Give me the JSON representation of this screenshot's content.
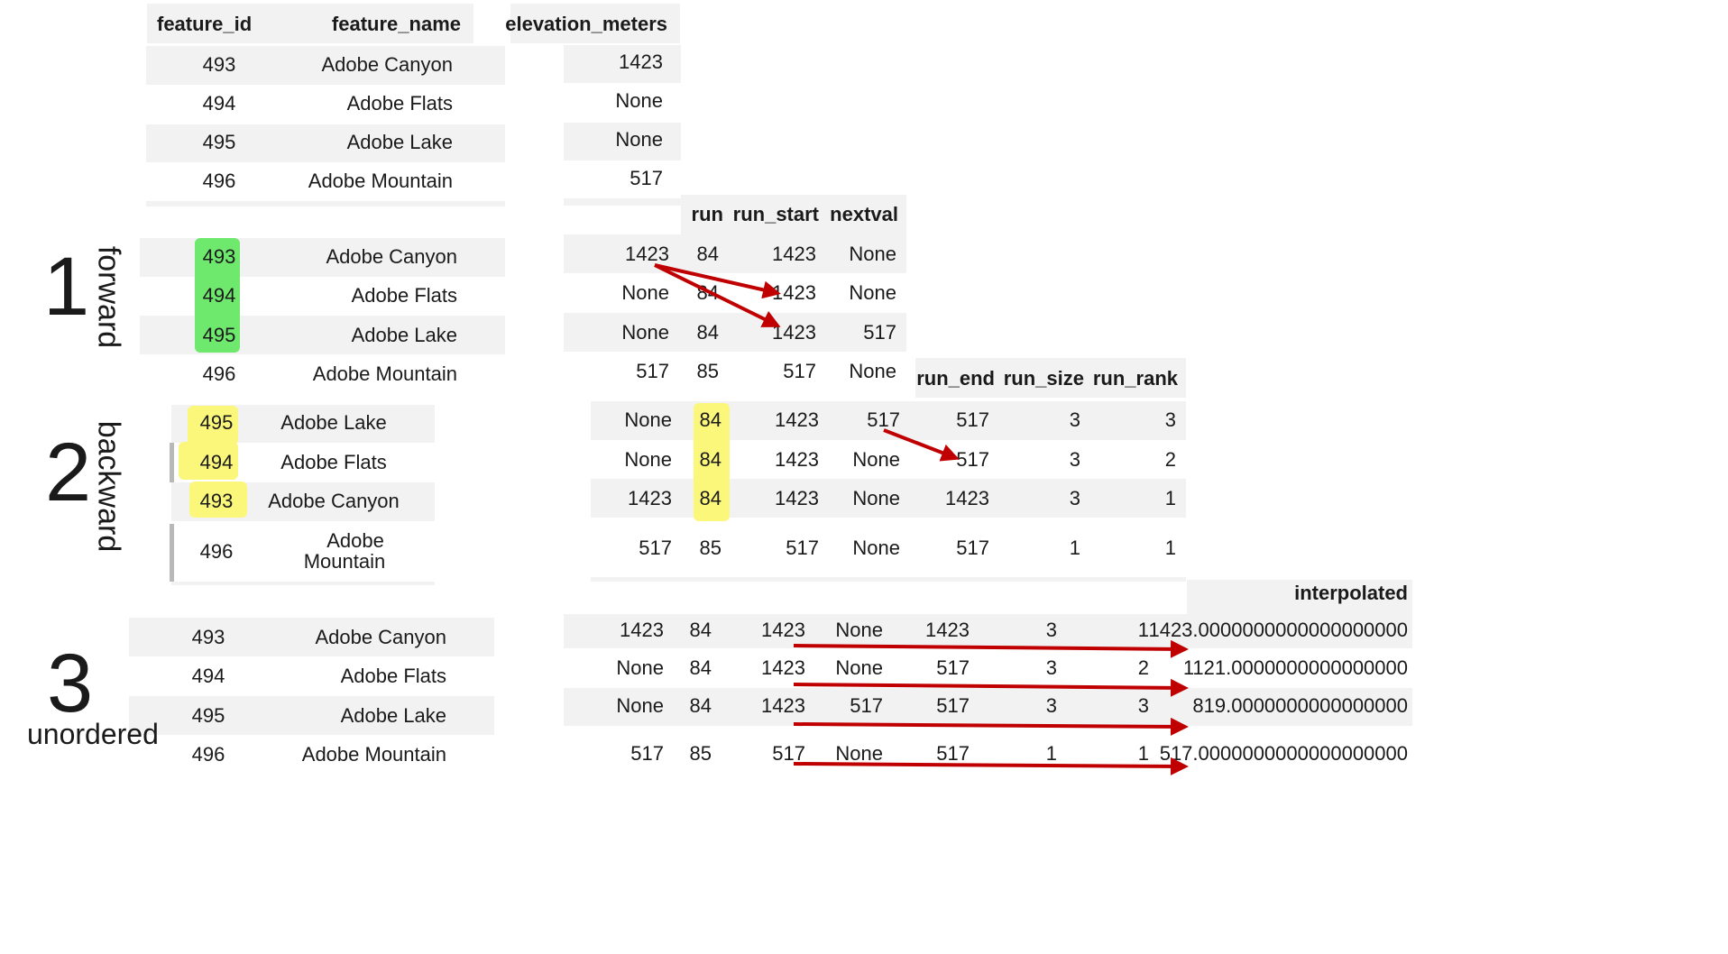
{
  "colors": {
    "row_band": "#f2f2f2",
    "green_highlight": "#6ee96e",
    "yellow_highlight": "#fbf77a",
    "arrow": "#c00000"
  },
  "section_labels": {
    "s1_number": "1",
    "s1_word": "forward",
    "s2_number": "2",
    "s2_word": "backward",
    "s3_number": "3",
    "s3_word": "unordered"
  },
  "headers": {
    "feature_id": "feature_id",
    "feature_name": "feature_name",
    "elevation_meters": "elevation_meters",
    "run": "run",
    "run_start": "run_start",
    "nextval": "nextval",
    "run_end": "run_end",
    "run_size": "run_size",
    "run_rank": "run_rank",
    "interpolated": "interpolated"
  },
  "table0": [
    {
      "id": "493",
      "name": "Adobe Canyon",
      "elev": "1423"
    },
    {
      "id": "494",
      "name": "Adobe Flats",
      "elev": "None"
    },
    {
      "id": "495",
      "name": "Adobe Lake",
      "elev": "None"
    },
    {
      "id": "496",
      "name": "Adobe Mountain",
      "elev": "517"
    }
  ],
  "forward": [
    {
      "id": "493",
      "name": "Adobe Canyon",
      "elev": "1423",
      "run": "84",
      "run_start": "1423",
      "nextval": "None"
    },
    {
      "id": "494",
      "name": "Adobe Flats",
      "elev": "None",
      "run": "84",
      "run_start": "1423",
      "nextval": "None"
    },
    {
      "id": "495",
      "name": "Adobe Lake",
      "elev": "None",
      "run": "84",
      "run_start": "1423",
      "nextval": "517"
    },
    {
      "id": "496",
      "name": "Adobe Mountain",
      "elev": "517",
      "run": "85",
      "run_start": "517",
      "nextval": "None"
    }
  ],
  "backward": [
    {
      "id": "495",
      "name": "Adobe Lake",
      "elev": "None",
      "run": "84",
      "run_start": "1423",
      "nextval": "517",
      "run_end": "517",
      "run_size": "3",
      "run_rank": "3"
    },
    {
      "id": "494",
      "name": "Adobe Flats",
      "elev": "None",
      "run": "84",
      "run_start": "1423",
      "nextval": "None",
      "run_end": "517",
      "run_size": "3",
      "run_rank": "2"
    },
    {
      "id": "493",
      "name": "Adobe Canyon",
      "elev": "1423",
      "run": "84",
      "run_start": "1423",
      "nextval": "None",
      "run_end": "1423",
      "run_size": "3",
      "run_rank": "1"
    },
    {
      "id": "496",
      "name_line1": "Adobe",
      "name_line2": "Mountain",
      "elev": "517",
      "run": "85",
      "run_start": "517",
      "nextval": "None",
      "run_end": "517",
      "run_size": "1",
      "run_rank": "1"
    }
  ],
  "unordered": [
    {
      "id": "493",
      "name": "Adobe Canyon",
      "elev": "1423",
      "run": "84",
      "run_start": "1423",
      "nextval": "None",
      "run_end": "1423",
      "run_size": "3",
      "run_rank": "1",
      "interpolated": "1423.0000000000000000000"
    },
    {
      "id": "494",
      "name": "Adobe Flats",
      "elev": "None",
      "run": "84",
      "run_start": "1423",
      "nextval": "None",
      "run_end": "517",
      "run_size": "3",
      "run_rank": "2",
      "interpolated": "1121.0000000000000000"
    },
    {
      "id": "495",
      "name": "Adobe Lake",
      "elev": "None",
      "run": "84",
      "run_start": "1423",
      "nextval": "517",
      "run_end": "517",
      "run_size": "3",
      "run_rank": "3",
      "interpolated": "819.0000000000000000"
    },
    {
      "id": "496",
      "name": "Adobe Mountain",
      "elev": "517",
      "run": "85",
      "run_start": "517",
      "nextval": "None",
      "run_end": "517",
      "run_size": "1",
      "run_rank": "1",
      "interpolated": "517.0000000000000000000"
    }
  ]
}
